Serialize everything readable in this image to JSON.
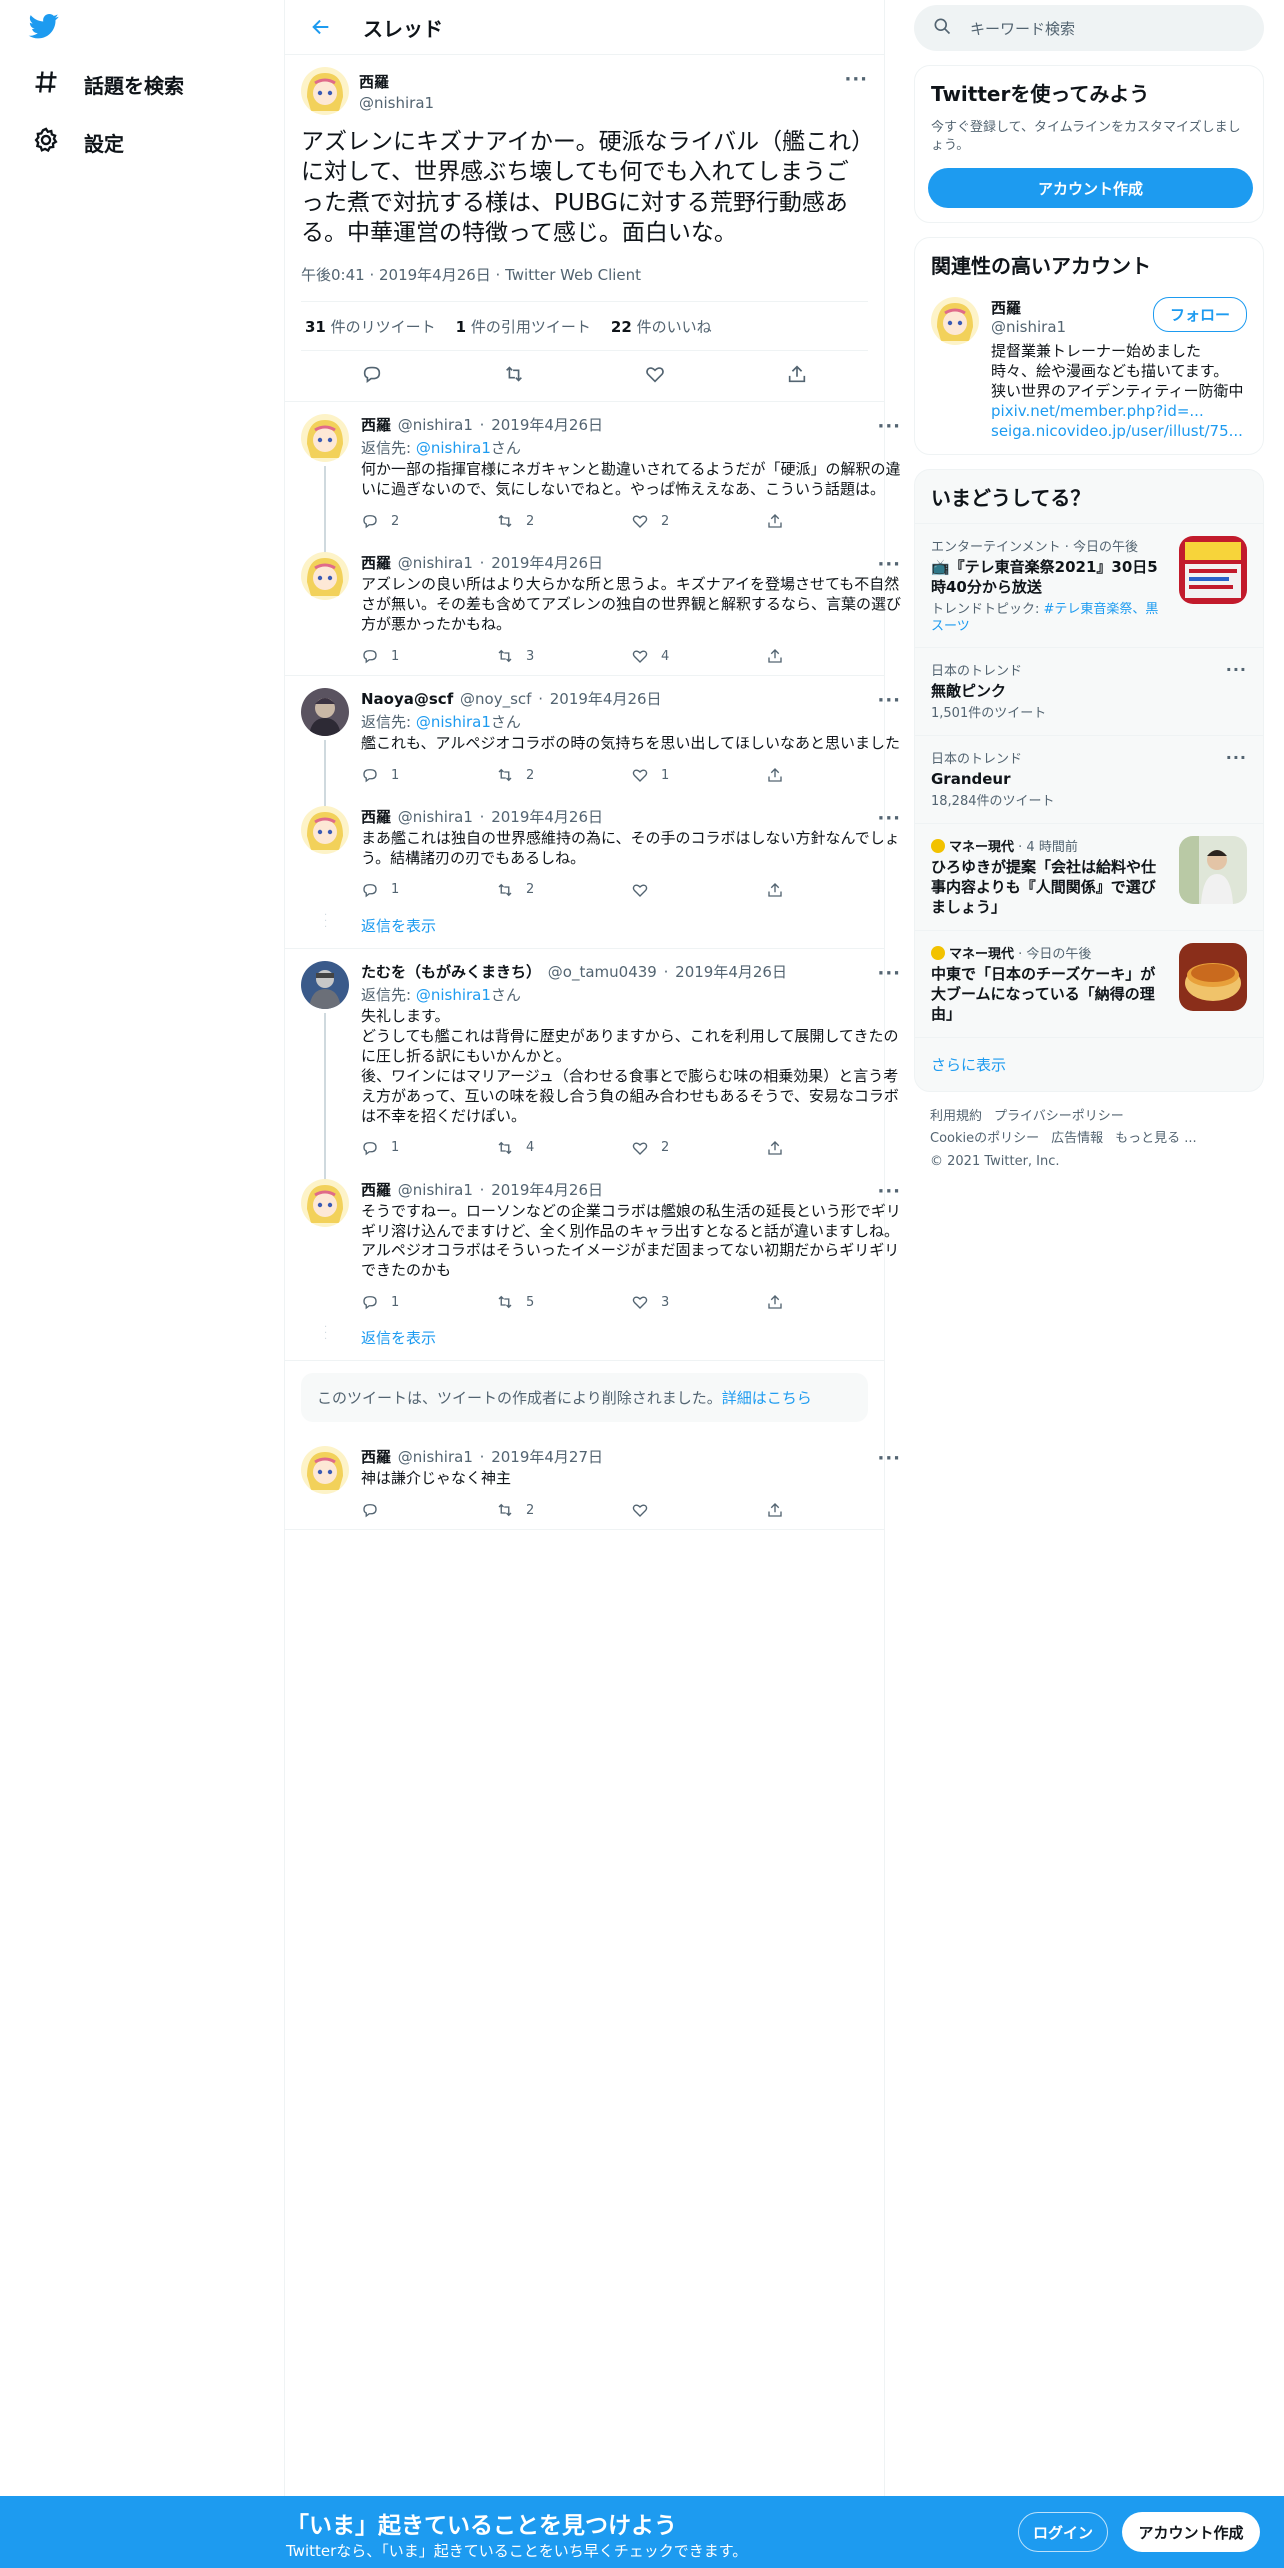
{
  "nav": {
    "explore_label": "話題を検索",
    "settings_label": "設定"
  },
  "thread": {
    "title": "スレッド",
    "main": {
      "name": "西羅",
      "handle": "@nishira1",
      "text": "アズレンにキズナアイかー。硬派なライバル（艦これ）に対して、世界感ぶち壊しても何でも入れてしまうごった煮で対抗する様は、PUBGに対する荒野行動感ある。中華運営の特徴って感じ。面白いな。",
      "meta": "午後0:41 · 2019年4月26日 · Twitter Web Client",
      "retweets_count": "31",
      "retweets_label": "件のリツイート",
      "quotes_count": "1",
      "quotes_label": "件の引用ツイート",
      "likes_count": "22",
      "likes_label": "件のいいね"
    },
    "replies": [
      {
        "name": "西羅",
        "handle": "@nishira1",
        "date": "2019年4月26日",
        "reply_prefix": "返信先: ",
        "reply_handle": "@nishira1",
        "reply_suffix": "さん",
        "text": "何か一部の指揮官様にネガキャンと勘違いされてるようだが「硬派」の解釈の違いに過ぎないので、気にしないでねと。やっぱ怖ええなあ、こういう話題は。",
        "replies": "2",
        "retweets": "2",
        "likes": "2"
      },
      {
        "name": "西羅",
        "handle": "@nishira1",
        "date": "2019年4月26日",
        "text": "アズレンの良い所はより大らかな所と思うよ。キズナアイを登場させても不自然さが無い。その差も含めてアズレンの独自の世界観と解釈するなら、言葉の選び方が悪かったかもね。",
        "replies": "1",
        "retweets": "3",
        "likes": "4"
      },
      {
        "name": "Naoya@scf",
        "handle": "@noy_scf",
        "date": "2019年4月26日",
        "reply_prefix": "返信先: ",
        "reply_handle": "@nishira1",
        "reply_suffix": "さん",
        "text": "艦これも、アルペジオコラボの時の気持ちを思い出してほしいなあと思いました",
        "replies": "1",
        "retweets": "2",
        "likes": "1"
      },
      {
        "name": "西羅",
        "handle": "@nishira1",
        "date": "2019年4月26日",
        "text": "まあ艦これは独自の世界感維持の為に、その手のコラボはしない方針なんでしょう。結構諸刃の刃でもあるしね。",
        "replies": "1",
        "retweets": "2",
        "likes": ""
      },
      {
        "name": "たむを（もがみくまきち）",
        "handle": "@o_tamu0439",
        "date": "2019年4月26日",
        "reply_prefix": "返信先: ",
        "reply_handle": "@nishira1",
        "reply_suffix": "さん",
        "text": "失礼します。\nどうしても艦これは背骨に歴史がありますから、これを利用して展開してきたのに圧し折る訳にもいかんかと。\n後、ワインにはマリアージュ（合わせる食事とで膨らむ味の相乗効果）と言う考え方があって、互いの味を殺し合う負の組み合わせもあるそうで、安易なコラボは不幸を招くだけぽい。",
        "replies": "1",
        "retweets": "4",
        "likes": "2"
      },
      {
        "name": "西羅",
        "handle": "@nishira1",
        "date": "2019年4月26日",
        "text": "そうですねー。ローソンなどの企業コラボは艦娘の私生活の延長という形でギリギリ溶け込んでますけど、全く別作品のキャラ出すとなると話が違いますしね。アルペジオコラボはそういったイメージがまだ固まってない初期だからギリギリできたのかも",
        "replies": "1",
        "retweets": "5",
        "likes": "3"
      },
      {
        "name": "西羅",
        "handle": "@nishira1",
        "date": "2019年4月27日",
        "text": "神は謙介じゃなく神主",
        "replies": "",
        "retweets": "2",
        "likes": ""
      }
    ],
    "show_replies_label": "返信を表示",
    "deleted_text": "このツイートは、ツイートの作成者により削除されました。",
    "deleted_link": "詳細はこちら"
  },
  "sidebar": {
    "search_placeholder": "キーワード検索",
    "signup_card": {
      "title": "Twitterを使ってみよう",
      "desc": "今すぐ登録して、タイムラインをカスタマイズしましょう。",
      "button": "アカウント作成"
    },
    "related": {
      "title": "関連性の高いアカウント",
      "name": "西羅",
      "handle": "@nishira1",
      "follow": "フォロー",
      "bio_1": "提督業兼トレーナー始めました",
      "bio_2": "時々、絵や漫画なども描いてます。",
      "bio_3": "狭い世界のアイデンティティー防衛中",
      "link_1": "pixiv.net/member.php?id=...",
      "link_2": "seiga.nicovideo.jp/user/illust/75..."
    },
    "trends": {
      "title": "いまどうしてる？",
      "items": [
        {
          "meta": "エンターテインメント · 今日の午後",
          "title": "📺『テレ東音楽祭2021』30日5時40分から放送",
          "sub_prefix": "トレンドトピック: ",
          "sub_link": "#テレ東音楽祭、黒スーツ"
        },
        {
          "meta": "日本のトレンド",
          "title": "無敵ピンク",
          "sub": "1,501件のツイート"
        },
        {
          "meta": "日本のトレンド",
          "title": "Grandeur",
          "sub": "18,284件のツイート"
        },
        {
          "source": "マネー現代",
          "time": " · 4 時間前",
          "title": "ひろゆきが提案「会社は給料や仕事内容よりも『人間関係』で選びましょう」"
        },
        {
          "source": "マネー現代",
          "time": " · 今日の午後",
          "title": "中東で「日本のチーズケーキ」が大ブームになっている「納得の理由」"
        }
      ],
      "show_more": "さらに表示"
    },
    "footer": {
      "terms": "利用規約",
      "privacy": "プライバシーポリシー",
      "cookie": "Cookieのポリシー",
      "ads": "広告情報",
      "more": "もっと見る ...",
      "copyright": "© 2021 Twitter, Inc."
    }
  },
  "bottombar": {
    "title": "「いま」起きていることを見つけよう",
    "subtitle": "Twitterなら、「いま」起きていることをいち早くチェックできます。",
    "login": "ログイン",
    "signup": "アカウント作成"
  },
  "colors": {
    "accent": "#1d9bf0",
    "text": "#0f1419",
    "muted": "#536471",
    "border": "#eff3f4"
  }
}
